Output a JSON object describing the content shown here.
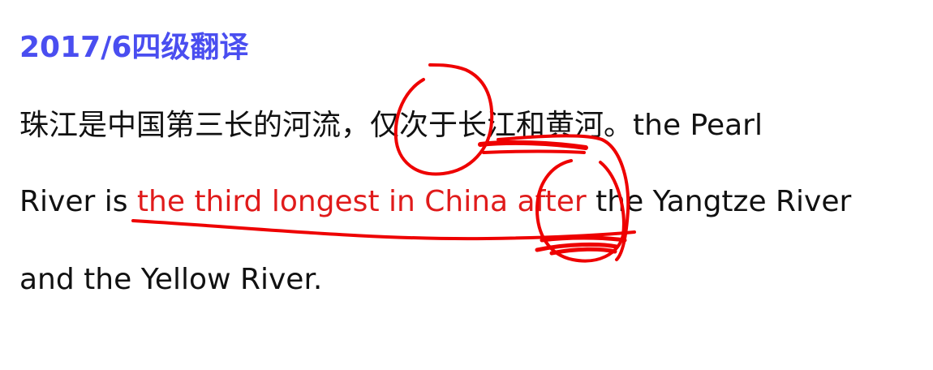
{
  "colors": {
    "title": "#4a4ef0",
    "body_text": "#111111",
    "highlight_text": "#e01b1b",
    "ink": "#ee0000"
  },
  "title": "2017/6四级翻译",
  "paragraph": {
    "line1_cn": "珠江是中国第三长的河流，仅次于长江和黄河。",
    "line1_en": "the Pearl",
    "line2_prefix": "River is ",
    "line2_highlight": "the third longest in China after",
    "line2_suffix": " the Yangtze River",
    "line3": "and the Yellow River."
  },
  "annotations": {
    "circles": [
      "仅次于",
      "after"
    ],
    "underline": "the third longest in China after"
  }
}
